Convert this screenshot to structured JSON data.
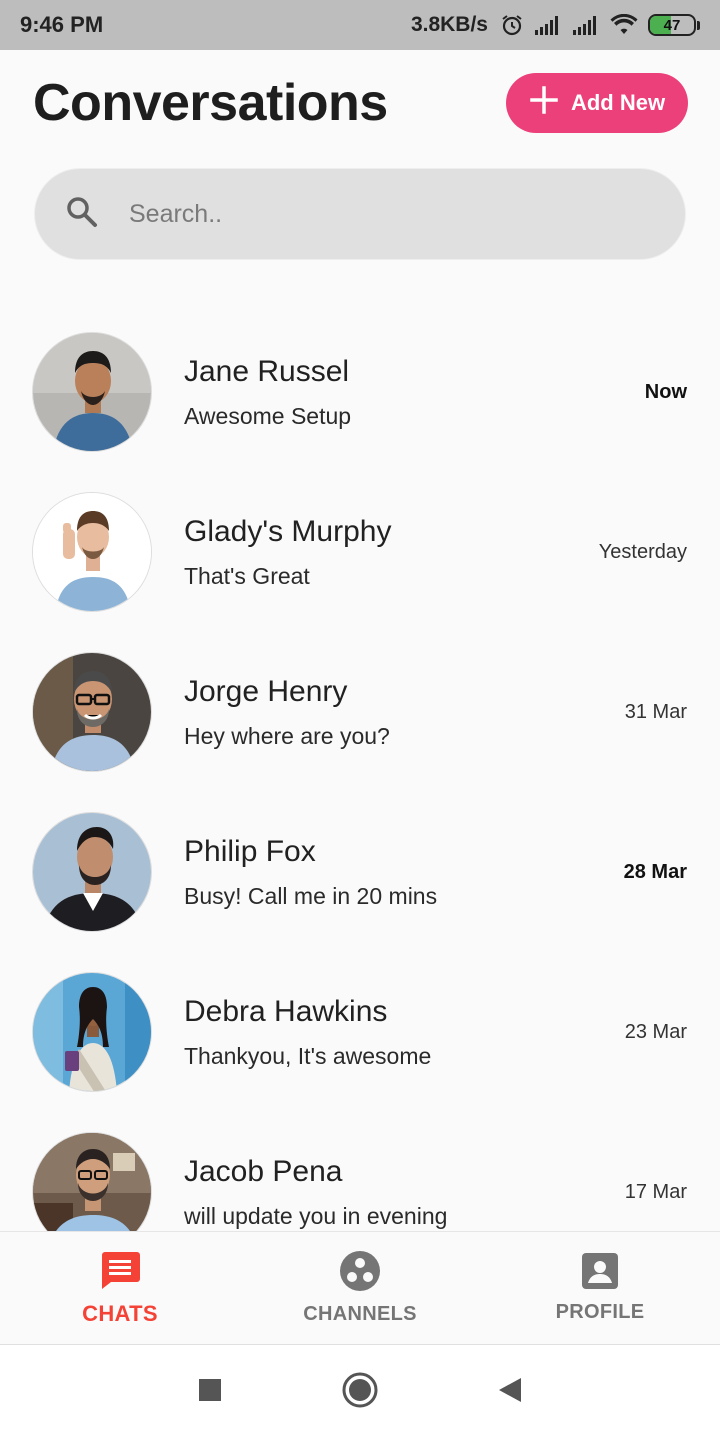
{
  "status_bar": {
    "time": "9:46 PM",
    "speed": "3.8KB/s",
    "battery": "47",
    "battery_level": 0.47,
    "icons": [
      "alarm-icon",
      "signal-icon",
      "signal-icon",
      "wifi-icon",
      "battery-icon"
    ]
  },
  "header": {
    "title": "Conversations",
    "add_button": "Add New",
    "accent": "#ec407a"
  },
  "search": {
    "placeholder": "Search.."
  },
  "conversations": [
    {
      "name": "Jane Russel",
      "message": "Awesome Setup",
      "time": "Now",
      "unread": true
    },
    {
      "name": "Glady's Murphy",
      "message": "That's Great",
      "time": "Yesterday",
      "unread": false
    },
    {
      "name": "Jorge Henry",
      "message": "Hey where are you?",
      "time": "31 Mar",
      "unread": false
    },
    {
      "name": "Philip Fox",
      "message": "Busy! Call me in 20 mins",
      "time": "28 Mar",
      "unread": true
    },
    {
      "name": "Debra Hawkins",
      "message": "Thankyou, It's awesome",
      "time": "23 Mar",
      "unread": false
    },
    {
      "name": "Jacob Pena",
      "message": "will update you in evening",
      "time": "17 Mar",
      "unread": false
    }
  ],
  "bottom_nav": {
    "items": [
      {
        "label": "CHATS",
        "icon": "chat-icon",
        "active": true
      },
      {
        "label": "CHANNELS",
        "icon": "channels-icon",
        "active": false
      },
      {
        "label": "PROFILE",
        "icon": "profile-icon",
        "active": false
      }
    ],
    "active_color": "#f44336",
    "inactive_color": "#757575"
  }
}
